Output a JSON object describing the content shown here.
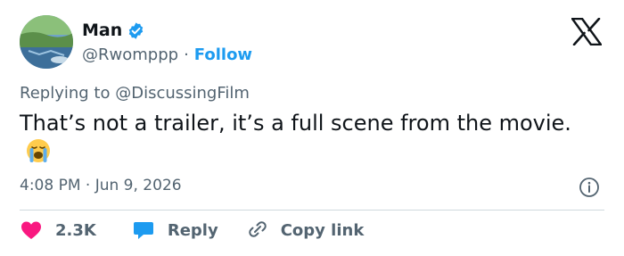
{
  "author": {
    "name": "Man",
    "handle": "@Rwomppp",
    "separator": "·",
    "follow_label": "Follow",
    "verified_color": "#1d9bf0"
  },
  "tweet": {
    "replying_prefix": "Replying to",
    "replying_to": "@DiscussingFilm",
    "text": "That’s not a trailer, it’s a full scene from the movie.",
    "emoji": "loudly-crying-face",
    "time": "4:08 PM",
    "meta_separator": "·",
    "date": "Jun 9, 2026"
  },
  "actions": {
    "like_count": "2.3K",
    "reply_label": "Reply",
    "copy_label": "Copy link"
  },
  "colors": {
    "accent": "#1d9bf0",
    "like": "#f91880",
    "muted": "#536471",
    "text": "#0f1419"
  },
  "icons": [
    "x-logo-icon",
    "verified-badge-icon",
    "info-icon",
    "heart-icon",
    "reply-bubble-icon",
    "link-icon"
  ]
}
